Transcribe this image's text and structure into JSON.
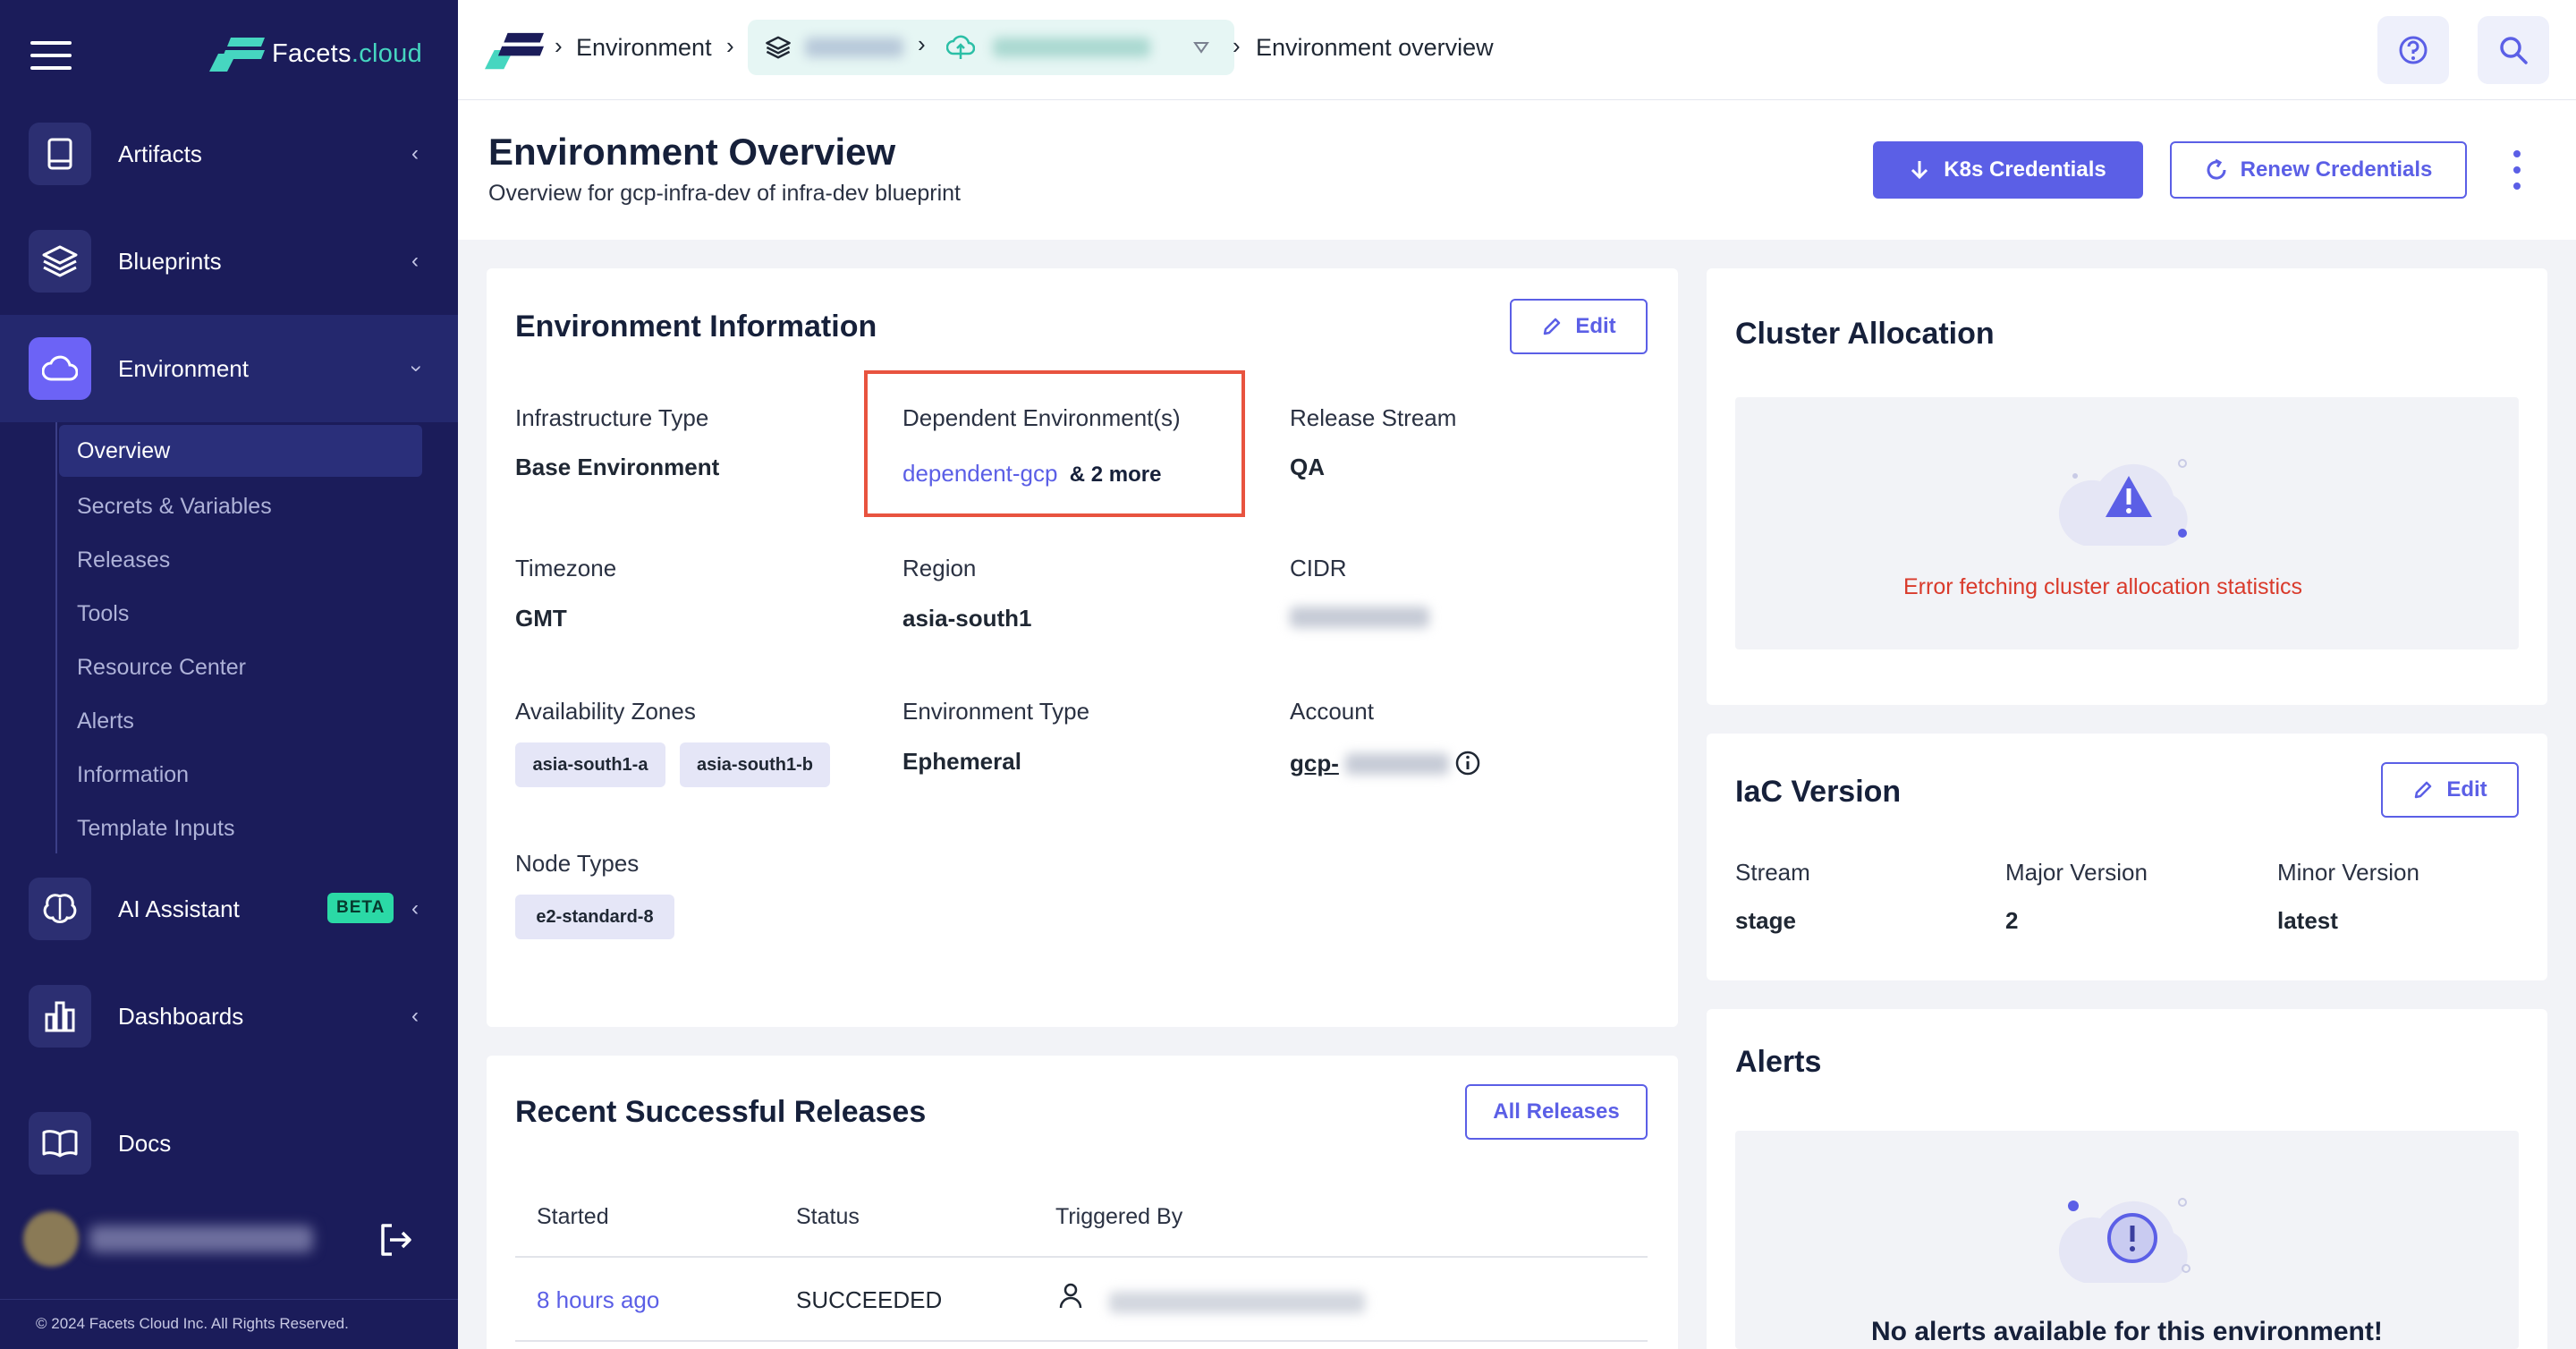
{
  "brand": {
    "name_prefix": "Facets",
    "name_suffix": ".cloud"
  },
  "sidebar": {
    "items": [
      {
        "label": "Artifacts",
        "icon": "book-icon"
      },
      {
        "label": "Blueprints",
        "icon": "layers-icon"
      },
      {
        "label": "Environment",
        "icon": "cloud-icon"
      },
      {
        "label": "AI Assistant",
        "icon": "brain-icon",
        "badge": "BETA"
      },
      {
        "label": "Dashboards",
        "icon": "bar-chart-icon"
      },
      {
        "label": "Docs",
        "icon": "open-book-icon"
      }
    ],
    "subitems": [
      "Overview",
      "Secrets & Variables",
      "Releases",
      "Tools",
      "Resource Center",
      "Alerts",
      "Information",
      "Template Inputs"
    ],
    "copyright": "© 2024 Facets Cloud Inc. All Rights Reserved."
  },
  "header": {
    "crumb_environment": "Environment",
    "crumb_current": "Environment overview"
  },
  "page": {
    "title": "Environment Overview",
    "subtitle": "Overview for gcp-infra-dev of infra-dev blueprint",
    "k8s_button": "K8s Credentials",
    "renew_button": "Renew Credentials"
  },
  "env_info": {
    "title": "Environment Information",
    "edit": "Edit",
    "infra_type_label": "Infrastructure Type",
    "infra_type_value": "Base Environment",
    "dependent_label": "Dependent Environment(s)",
    "dependent_link": "dependent-gcp",
    "dependent_more": "& 2 more",
    "release_stream_label": "Release Stream",
    "release_stream_value": "QA",
    "timezone_label": "Timezone",
    "timezone_value": "GMT",
    "region_label": "Region",
    "region_value": "asia-south1",
    "cidr_label": "CIDR",
    "az_label": "Availability Zones",
    "az_values": [
      "asia-south1-a",
      "asia-south1-b"
    ],
    "env_type_label": "Environment Type",
    "env_type_value": "Ephemeral",
    "account_label": "Account",
    "account_prefix": "gcp-",
    "node_types_label": "Node Types",
    "node_types_values": [
      "e2-standard-8"
    ]
  },
  "cluster": {
    "title": "Cluster Allocation",
    "error": "Error fetching cluster allocation statistics"
  },
  "iac": {
    "title": "IaC Version",
    "edit": "Edit",
    "stream_label": "Stream",
    "stream_value": "stage",
    "major_label": "Major Version",
    "major_value": "2",
    "minor_label": "Minor Version",
    "minor_value": "latest"
  },
  "alerts": {
    "title": "Alerts",
    "empty": "No alerts available for this environment!"
  },
  "releases": {
    "title": "Recent Successful Releases",
    "all_button": "All Releases",
    "columns": [
      "Started",
      "Status",
      "Triggered By"
    ],
    "rows": [
      {
        "started": "8 hours ago",
        "status": "SUCCEEDED"
      }
    ]
  },
  "colors": {
    "sidebar_bg": "#1b1c5a",
    "accent": "#5b5fe6",
    "highlight": "#e8533f",
    "error": "#d93a2b",
    "brand_teal": "#46d6c0"
  }
}
